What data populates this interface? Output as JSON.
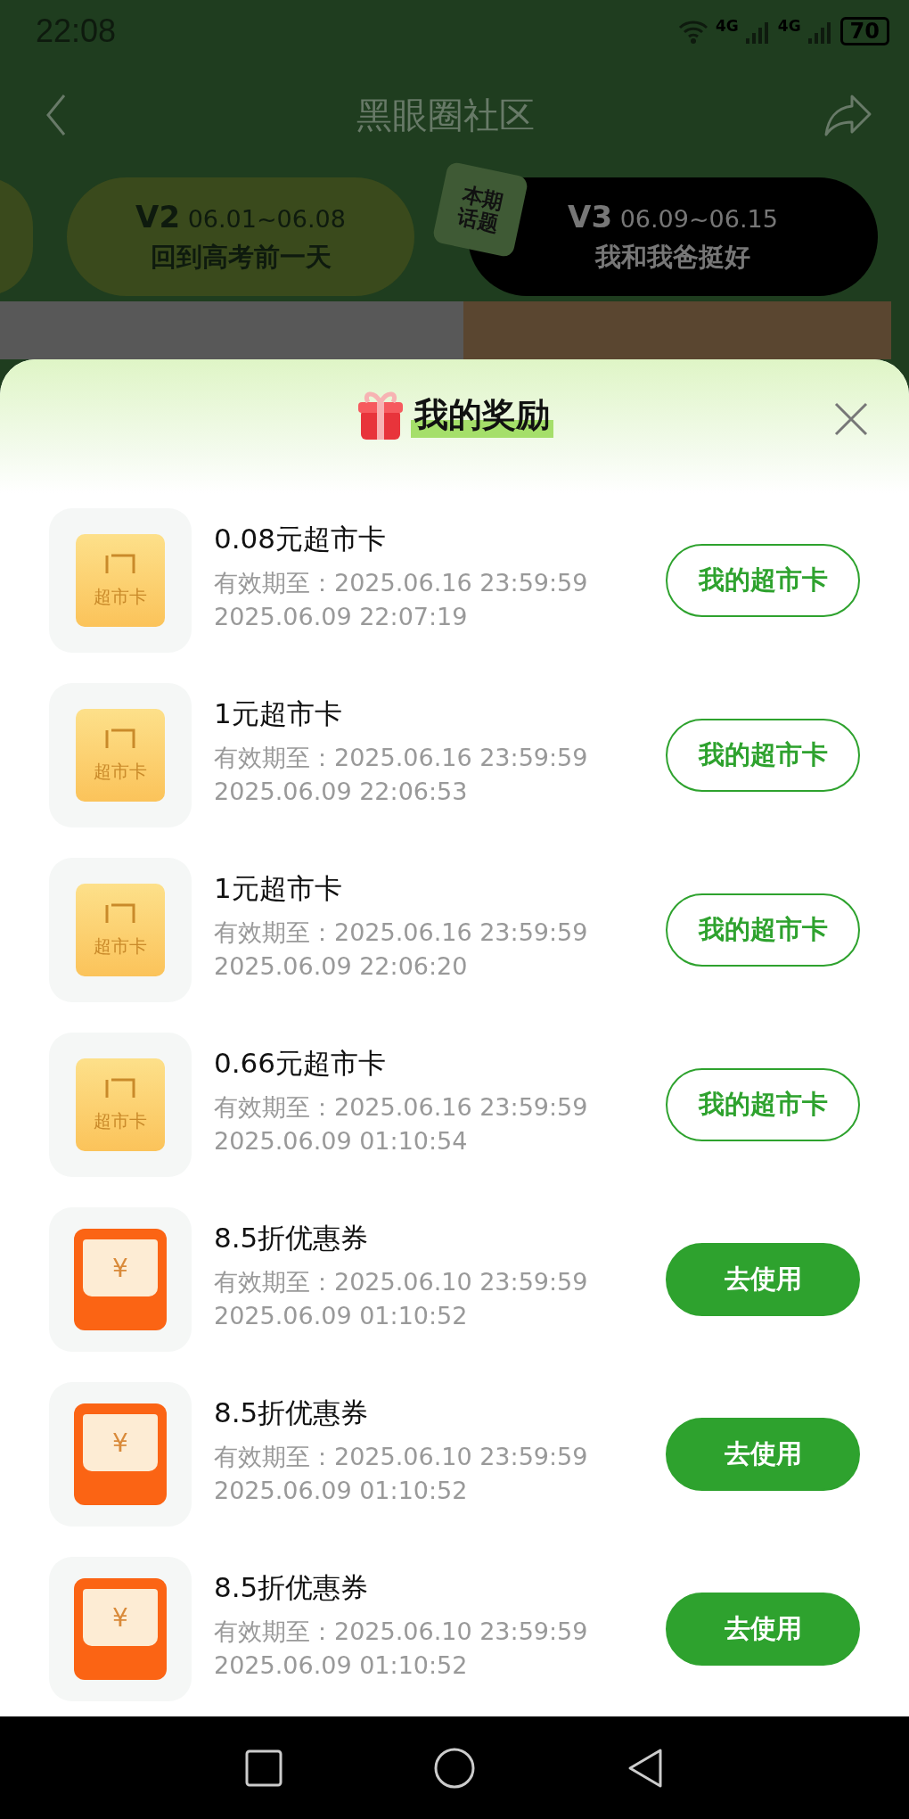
{
  "status_bar": {
    "time": "22:08",
    "networks": [
      "4G",
      "4G"
    ],
    "battery": "70"
  },
  "header": {
    "title": "黑眼圈社区"
  },
  "topics": [
    {
      "version": "V2",
      "dates": "06.01~06.08",
      "title": "回到高考前一天",
      "selected": false
    },
    {
      "version": "V3",
      "dates": "06.09~06.15",
      "title": "我和我爸挺好",
      "selected": true
    }
  ],
  "topic_badge": [
    "本期",
    "话题"
  ],
  "rewards": {
    "title": "我的奖励",
    "items": [
      {
        "kind": "card",
        "icon_label": "超市卡",
        "title": "0.08元超市卡",
        "validity": "有效期至：2025.06.16 23:59:59",
        "time": "2025.06.09 22:07:19",
        "action": {
          "kind": "outline",
          "label": "我的超市卡"
        }
      },
      {
        "kind": "card",
        "icon_label": "超市卡",
        "title": "1元超市卡",
        "validity": "有效期至：2025.06.16 23:59:59",
        "time": "2025.06.09 22:06:53",
        "action": {
          "kind": "outline",
          "label": "我的超市卡"
        }
      },
      {
        "kind": "card",
        "icon_label": "超市卡",
        "title": "1元超市卡",
        "validity": "有效期至：2025.06.16 23:59:59",
        "time": "2025.06.09 22:06:20",
        "action": {
          "kind": "outline",
          "label": "我的超市卡"
        }
      },
      {
        "kind": "card",
        "icon_label": "超市卡",
        "title": "0.66元超市卡",
        "validity": "有效期至：2025.06.16 23:59:59",
        "time": "2025.06.09 01:10:54",
        "action": {
          "kind": "outline",
          "label": "我的超市卡"
        }
      },
      {
        "kind": "coupon",
        "icon_label": "¥",
        "title": "8.5折优惠券",
        "validity": "有效期至：2025.06.10 23:59:59",
        "time": "2025.06.09 01:10:52",
        "action": {
          "kind": "filled",
          "label": "去使用"
        }
      },
      {
        "kind": "coupon",
        "icon_label": "¥",
        "title": "8.5折优惠券",
        "validity": "有效期至：2025.06.10 23:59:59",
        "time": "2025.06.09 01:10:52",
        "action": {
          "kind": "filled",
          "label": "去使用"
        }
      },
      {
        "kind": "coupon",
        "icon_label": "¥",
        "title": "8.5折优惠券",
        "validity": "有效期至：2025.06.10 23:59:59",
        "time": "2025.06.09 01:10:52",
        "action": {
          "kind": "filled",
          "label": "去使用"
        }
      }
    ]
  }
}
